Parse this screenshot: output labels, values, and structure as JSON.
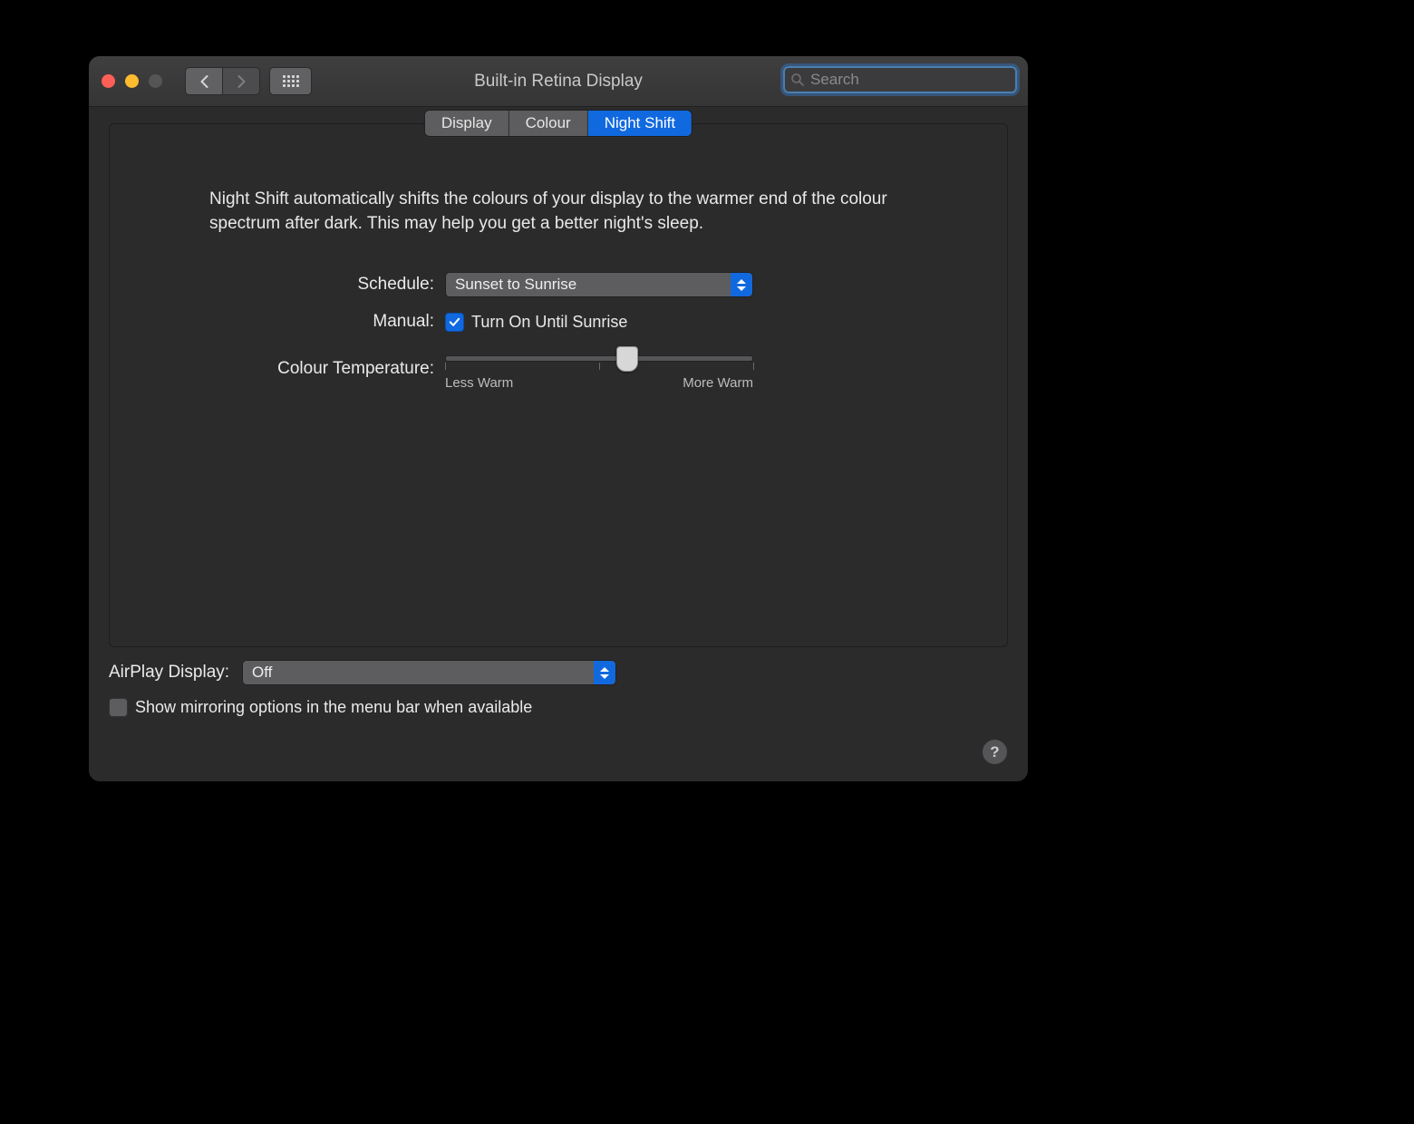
{
  "window": {
    "title": "Built-in Retina Display"
  },
  "search": {
    "placeholder": "Search"
  },
  "tabs": [
    {
      "label": "Display",
      "active": false
    },
    {
      "label": "Colour",
      "active": false
    },
    {
      "label": "Night Shift",
      "active": true
    }
  ],
  "nightshift": {
    "description": "Night Shift automatically shifts the colours of your display to the warmer end of the colour spectrum after dark. This may help you get a better night's sleep.",
    "schedule_label": "Schedule:",
    "schedule_value": "Sunset to Sunrise",
    "manual_label": "Manual:",
    "manual_checkbox_label": "Turn On Until Sunrise",
    "manual_checked": true,
    "temperature_label": "Colour Temperature:",
    "slider_min_label": "Less Warm",
    "slider_max_label": "More Warm",
    "slider_position_percent": 59
  },
  "airplay": {
    "label": "AirPlay Display:",
    "value": "Off"
  },
  "mirroring": {
    "label": "Show mirroring options in the menu bar when available",
    "checked": false
  },
  "help": {
    "symbol": "?"
  }
}
